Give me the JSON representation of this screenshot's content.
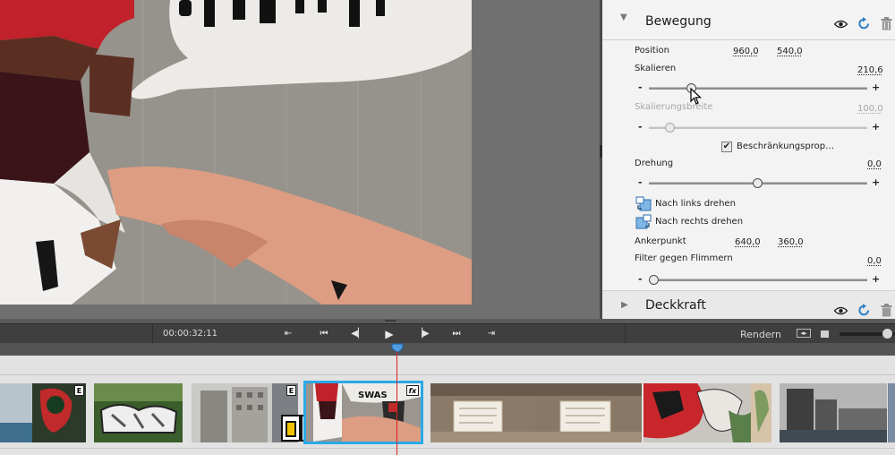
{
  "panel": {
    "motion": {
      "title": "Bewegung",
      "position_label": "Position",
      "position_x": "960,0",
      "position_y": "540,0",
      "scale_label": "Skalieren",
      "scale_value": "210,6",
      "scale_width_label": "Skalierungsbreite",
      "scale_width_value": "100,0",
      "constrain_label": "Beschränkungsproportionen",
      "rotation_label": "Drehung",
      "rotation_value": "0,0",
      "rotate_left_label": "Nach links drehen",
      "rotate_right_label": "Nach rechts drehen",
      "anchor_label": "Ankerpunkt",
      "anchor_x": "640,0",
      "anchor_y": "360,0",
      "flicker_label": "Filter gegen Flimmern",
      "flicker_value": "0,0",
      "minus": "-",
      "plus": "+"
    },
    "opacity": {
      "title": "Deckkraft"
    }
  },
  "transport": {
    "timecode": "00:00:32:11",
    "render_label": "Rendern"
  },
  "timeline": {
    "badge_e": "E",
    "badge_fx": "fx"
  },
  "colors": {
    "accent": "#2f7fc4",
    "playhead": "#e02020",
    "selection": "#2aa9e8"
  }
}
